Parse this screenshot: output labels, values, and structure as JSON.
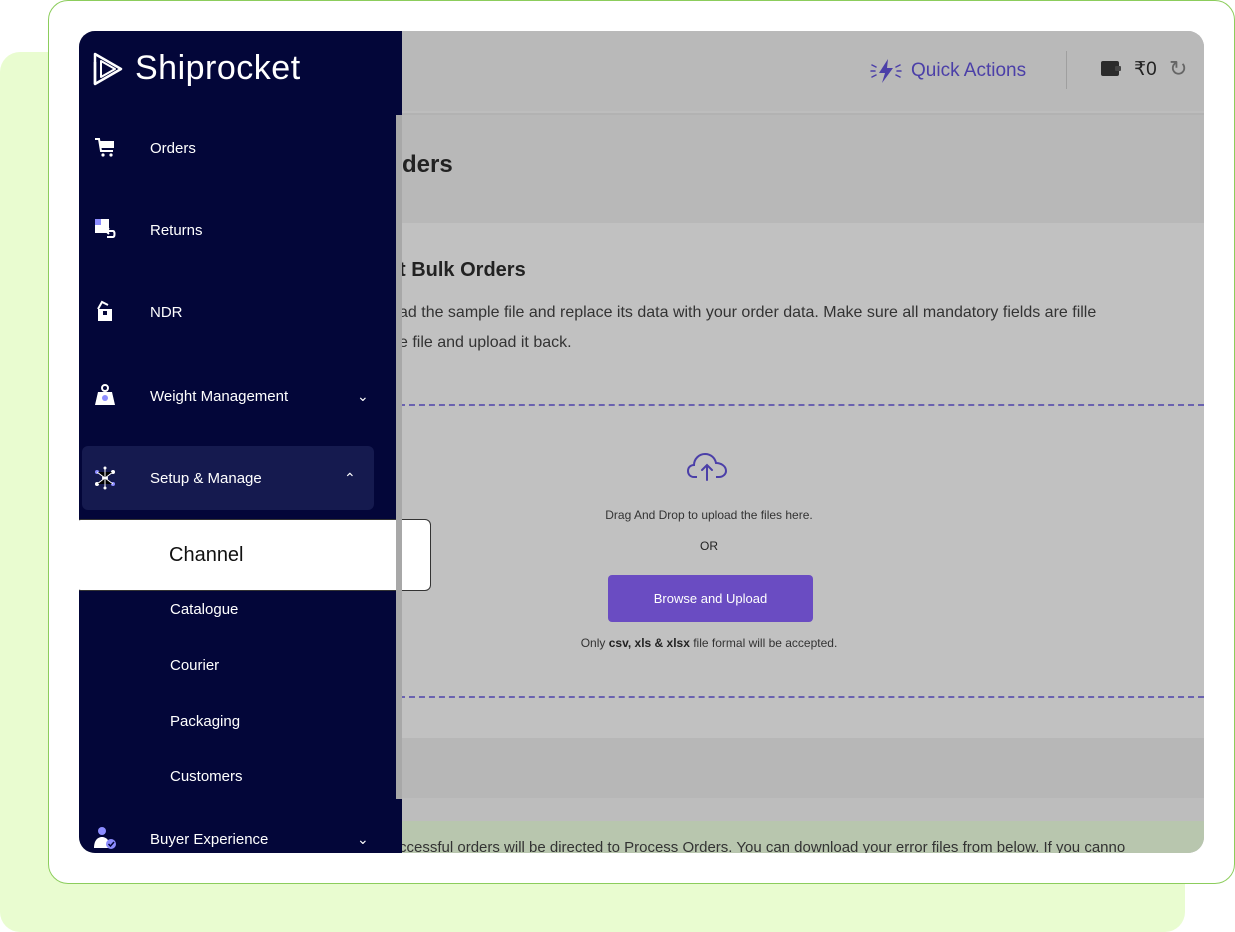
{
  "brand": {
    "name": "Shiprocket"
  },
  "topbar": {
    "quick_actions": "Quick Actions",
    "balance": "₹0"
  },
  "sidebar": {
    "items": [
      {
        "label": "Orders"
      },
      {
        "label": "Returns"
      },
      {
        "label": "NDR"
      },
      {
        "label": "Weight Management"
      },
      {
        "label": "Setup & Manage"
      },
      {
        "label": "Buyer Experience"
      }
    ],
    "sub_items": [
      {
        "label": "Channel"
      },
      {
        "label": "Catalogue"
      },
      {
        "label": "Courier"
      },
      {
        "label": "Packaging"
      },
      {
        "label": "Customers"
      }
    ]
  },
  "main": {
    "page_title": "ders",
    "section_title": "t Bulk Orders",
    "desc_line1": "ad the sample file and replace its data with your order data. Make sure all mandatory fields are fille",
    "desc_line2": "e file and upload it back.",
    "drag_text": "Drag And Drop to upload the files here.",
    "or_text": "OR",
    "browse_button": "Browse and Upload",
    "format_prefix": "Only ",
    "format_types": "csv, xls & xlsx",
    "format_suffix": " file formal will be accepted.",
    "footer_text": "ccessful orders will be directed to Process Orders. You can download your error files from below. If you canno"
  },
  "colors": {
    "sidebar_bg": "#030639",
    "accent": "#6a4cc2",
    "frame_border": "#8ccd5c",
    "backdrop": "#e9fcd0"
  }
}
